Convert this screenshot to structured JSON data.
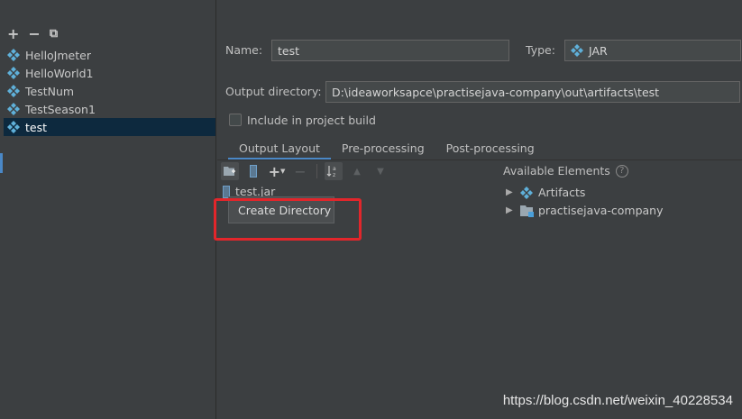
{
  "sidebar": {
    "toolbar": {
      "add": "+",
      "remove": "−",
      "copy": "⧉"
    },
    "artifacts": [
      {
        "label": "HelloJmeter"
      },
      {
        "label": "HelloWorld1"
      },
      {
        "label": "TestNum"
      },
      {
        "label": "TestSeason1"
      },
      {
        "label": "test"
      }
    ],
    "selected_index": 4
  },
  "form": {
    "name_label": "Name:",
    "name_value": "test",
    "type_label": "Type:",
    "type_value": "JAR",
    "output_dir_label": "Output directory:",
    "output_dir_value": "D:\\ideaworksapce\\practisejava-company\\out\\artifacts\\test",
    "include_build_label": "Include in project build",
    "include_build_checked": false
  },
  "tabs": [
    {
      "label": "Output Layout",
      "active": true
    },
    {
      "label": "Pre-processing",
      "active": false
    },
    {
      "label": "Post-processing",
      "active": false
    }
  ],
  "layout": {
    "root_item": "test.jar",
    "popup_label": "Create Directory"
  },
  "available": {
    "title": "Available Elements",
    "help": "?",
    "items": [
      {
        "label": "Artifacts"
      },
      {
        "label": "practisejava-company"
      }
    ]
  },
  "watermark": "https://blog.csdn.net/weixin_40228534",
  "colors": {
    "background": "#3c3f41",
    "selection": "#0d293e",
    "accent": "#4a88c7",
    "highlight_box": "#e2262b"
  }
}
